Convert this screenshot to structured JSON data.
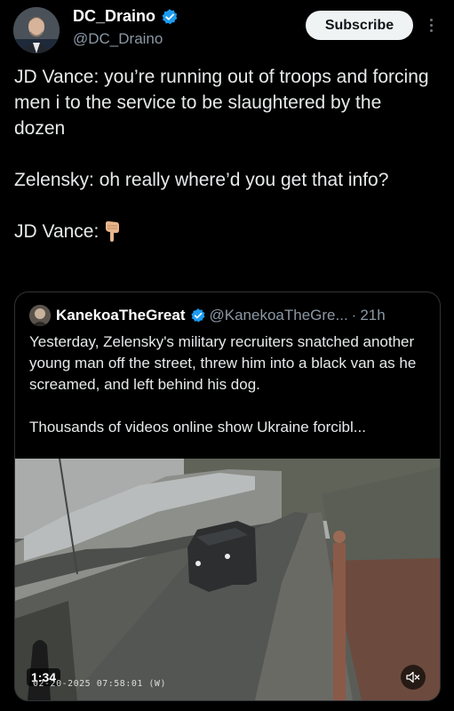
{
  "author": {
    "display_name": "DC_Draino",
    "handle": "@DC_Draino",
    "avatar_icon": "profile-photo-icon",
    "verified_icon": "verified-badge-icon"
  },
  "actions": {
    "subscribe_label": "Subscribe",
    "more_icon": "more-vertical-icon"
  },
  "tweet": {
    "lines": [
      "JD Vance: you’re running out of troops and forcing men i to the service to be slaughtered by the dozen",
      "Zelensky: oh really where’d you get that info?",
      "JD Vance:"
    ],
    "emoji_icon": "hand-pointing-down-icon"
  },
  "quote": {
    "display_name": "KanekoaTheGreat",
    "handle": "@KanekoaTheGre...",
    "separator": "·",
    "time": "21h",
    "paragraphs": [
      "Yesterday, Zelensky's military recruiters snatched another young man off the street, threw him into a black van as he screamed, and left behind his dog.",
      "Thousands of videos online show Ukraine forcibl..."
    ],
    "video": {
      "duration": "1:34",
      "timestamp": "02-20-2025 07:58:01 (W)",
      "mute_icon": "volume-muted-icon"
    }
  },
  "colors": {
    "background": "#000000",
    "text": "#e7e9ea",
    "muted_text": "#8b98a5",
    "verified": "#1d9bf0",
    "button_bg": "#eff3f4",
    "border": "#2f3336"
  }
}
